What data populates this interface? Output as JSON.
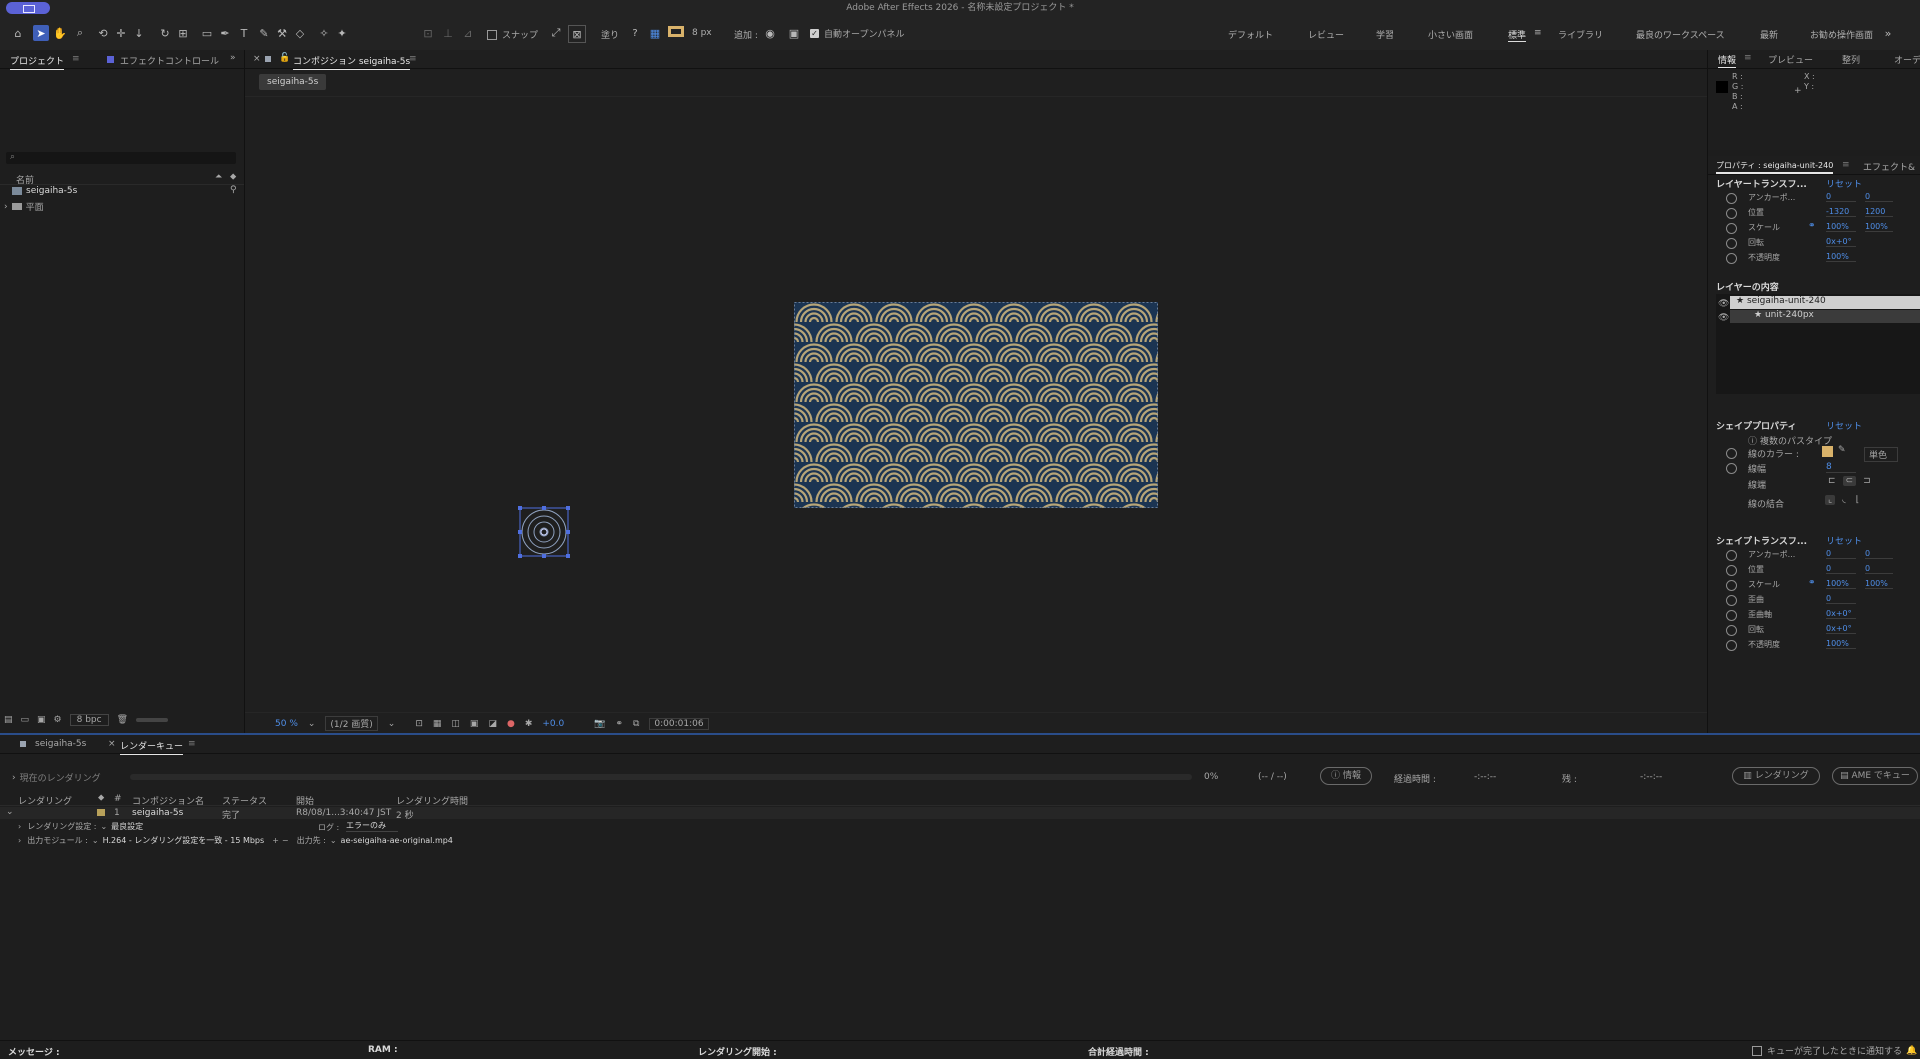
{
  "window": {
    "title": "Adobe After Effects 2026 - 名称未設定プロジェクト *"
  },
  "toolbar": {
    "snap_label": "スナップ",
    "fill_label": "塗り",
    "fill_help": "?",
    "stroke_px": "8 px",
    "add_label": "追加 :",
    "auto_open_label": "自動オープンパネル"
  },
  "workspaces": [
    "デフォルト",
    "レビュー",
    "学習",
    "小さい画面",
    "標準",
    "ライブラリ",
    "最良のワークスペース",
    "最新",
    "お勧め操作画面"
  ],
  "project_panel": {
    "tabs": [
      "プロジェクト",
      "エフェクトコントロール"
    ],
    "column_name": "名前",
    "items": [
      {
        "name": "seigaiha-5s",
        "icon": "composition-icon"
      },
      {
        "name": "平面",
        "icon": "folder-icon"
      }
    ],
    "bpc": "8 bpc"
  },
  "composition_panel": {
    "tab_label": "コンポジション seigaiha-5s",
    "comp_chip": "seigaiha-5s",
    "zoom": "50 %",
    "resolution": "(1/2 画質)",
    "exposure": "+0.0",
    "timecode": "0:00:01:06",
    "pattern_colors": {
      "background": "#1b3452",
      "waves": "#b7a578"
    }
  },
  "info_panel": {
    "tabs": [
      "情報",
      "プレビュー",
      "整列",
      "オーデ"
    ],
    "channels": [
      "R :",
      "G :",
      "B :",
      "A :"
    ],
    "xy": [
      "X :",
      "Y :"
    ]
  },
  "properties_panel": {
    "title": "プロパティ : seigaiha-unit-240",
    "tab2": "エフェクト&",
    "layer_transform": {
      "heading": "レイヤートランスフ...",
      "reset": "リセット",
      "rows": [
        {
          "label": "アンカーポ...",
          "v1": "0",
          "v2": "0"
        },
        {
          "label": "位置",
          "v1": "-1320",
          "v2": "1200"
        },
        {
          "label": "スケール",
          "v1": "100%",
          "v2": "100%"
        },
        {
          "label": "回転",
          "v1": "0x+0°",
          "v2": ""
        },
        {
          "label": "不透明度",
          "v1": "100%",
          "v2": ""
        }
      ]
    },
    "layer_contents": {
      "heading": "レイヤーの内容",
      "items": [
        "seigaiha-unit-240",
        "unit-240px"
      ]
    },
    "shape_properties": {
      "heading": "シェイププロパティ",
      "reset": "リセット",
      "multi_path": "複数のパスタイプ",
      "stroke_color_label": "線のカラー :",
      "stroke_color": "#d9b26a",
      "stroke_mode": "単色",
      "stroke_width_label": "線幅",
      "stroke_width": "8",
      "cap_label": "線端",
      "join_label": "線の結合"
    },
    "shape_transform": {
      "heading": "シェイプトランスフ...",
      "reset": "リセット",
      "rows": [
        {
          "label": "アンカーポ...",
          "v1": "0",
          "v2": "0"
        },
        {
          "label": "位置",
          "v1": "0",
          "v2": "0"
        },
        {
          "label": "スケール",
          "v1": "100%",
          "v2": "100%"
        },
        {
          "label": "歪曲",
          "v1": "0",
          "v2": ""
        },
        {
          "label": "歪曲軸",
          "v1": "0x+0°",
          "v2": ""
        },
        {
          "label": "回転",
          "v1": "0x+0°",
          "v2": ""
        },
        {
          "label": "不透明度",
          "v1": "100%",
          "v2": ""
        }
      ]
    }
  },
  "render_queue": {
    "tabs": [
      "seigaiha-5s",
      "レンダーキュー"
    ],
    "current_label": "現在のレンダリング",
    "percent": "0%",
    "frames": "(-- / --)",
    "info_button": "情報",
    "elapsed_label": "経過時間 :",
    "elapsed_value": "-:--:--",
    "remaining_label": "残 :",
    "remaining_value": "-:--:--",
    "render_button": "レンダリング",
    "ame_button": "AME でキュー",
    "columns": [
      "レンダリング",
      "#",
      "コンポジション名",
      "ステータス",
      "開始",
      "レンダリング時間"
    ],
    "row": {
      "index": "1",
      "comp": "seigaiha-5s",
      "status": "完了",
      "started": "R8/08/1...3:40:47 JST",
      "render_time": "2 秒"
    },
    "render_settings_label": "レンダリング設定 :",
    "render_settings_value": "最良設定",
    "log_label": "ログ :",
    "log_value": "エラーのみ",
    "output_module_label": "出力モジュール :",
    "output_module_value": "H.264 - レンダリング設定を一致 - 15 Mbps",
    "output_to_label": "出力先 :",
    "output_to_value": "ae-seigaiha-ae-original.mp4"
  },
  "status_bar": {
    "message": "メッセージ :",
    "ram": "RAM :",
    "render_start": "レンダリング開始 :",
    "total_elapsed": "合計経過時間 :",
    "notify": "キューが完了したときに通知する"
  }
}
